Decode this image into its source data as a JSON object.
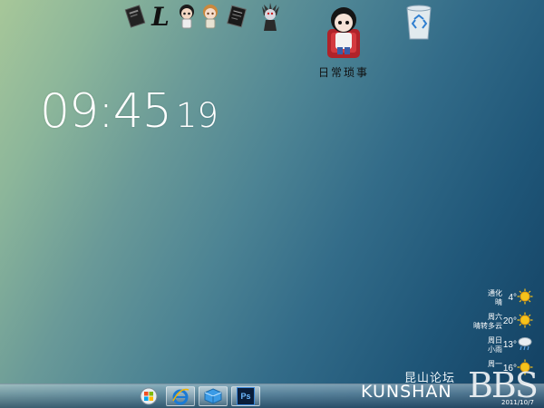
{
  "clock": {
    "hours_minutes": "09:45",
    "seconds": "19"
  },
  "desktop": {
    "folder_label": "日常琐事"
  },
  "weather": [
    {
      "line1": "通化",
      "line2": "晴",
      "temp": "4°",
      "icon": "sunny-icon"
    },
    {
      "line1": "周六",
      "line2": "晴转多云",
      "temp": "20°",
      "icon": "sunny-icon"
    },
    {
      "line1": "周日",
      "line2": "小雨",
      "temp": "13°",
      "icon": "rain-icon"
    },
    {
      "line1": "周一",
      "line2": "",
      "temp": "16°",
      "icon": "sunny-icon"
    }
  ],
  "watermark": {
    "cn": "昆山论坛",
    "en": "KUNSHAN",
    "bbs": "BBS",
    "date": "2011/10/7"
  },
  "dock_icons": [
    "notebook-icon",
    "l-letter-icon",
    "chibi-character-icon",
    "chibi-character-icon",
    "notebook-icon",
    "shinigami-icon"
  ],
  "taskbar_icons": [
    "start-icon",
    "internet-explorer-icon",
    "cube-app-icon",
    "photoshop-icon"
  ],
  "taskbar": {
    "ps_label": "Ps"
  },
  "dock": {
    "l_glyph": "L"
  },
  "colors": {
    "wallpaper_start": "#a7c799",
    "wallpaper_end": "#123f61"
  }
}
